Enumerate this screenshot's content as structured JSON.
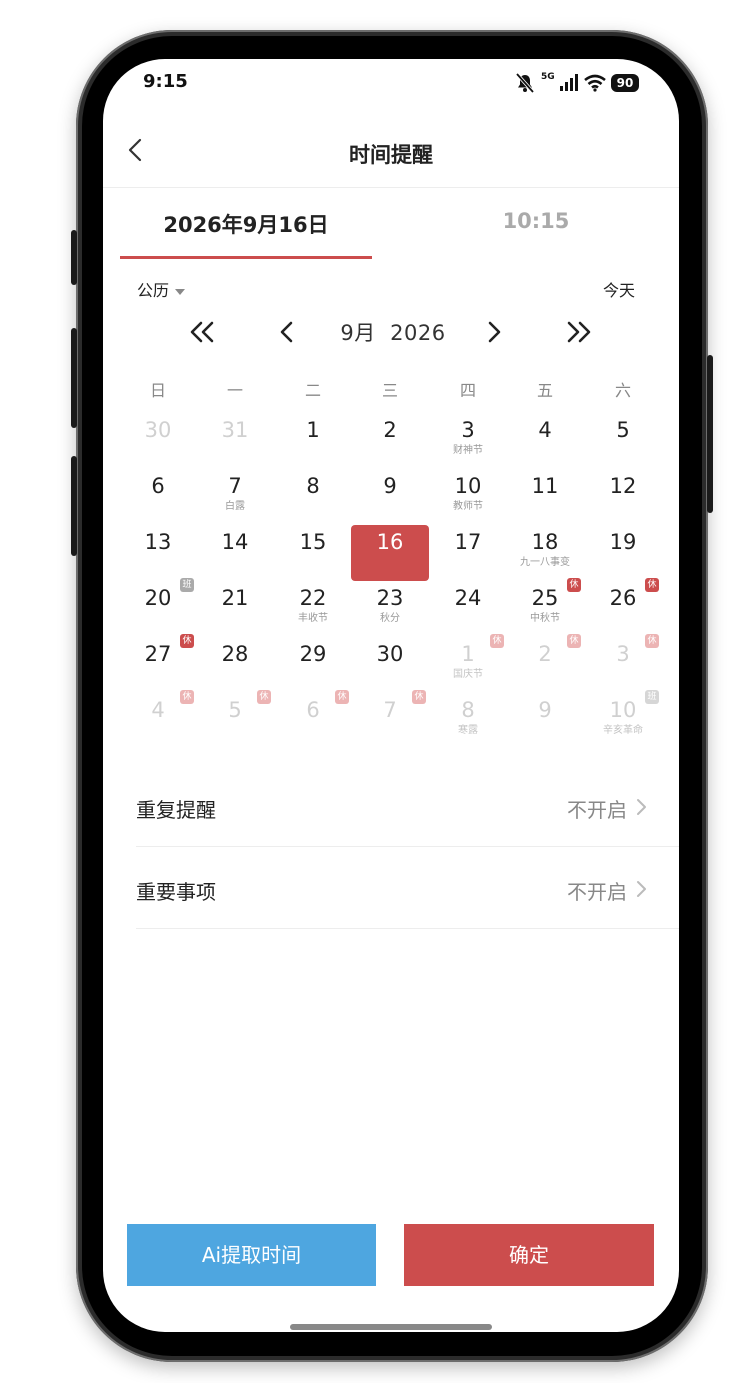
{
  "status_bar": {
    "time": "9:15",
    "network": "5G",
    "battery": "90"
  },
  "nav": {
    "title": "时间提醒"
  },
  "tabs": {
    "date": "2026年9月16日",
    "time": "10:15"
  },
  "calendar": {
    "type_label": "公历",
    "today_label": "今天",
    "month": "9月",
    "year": "2026",
    "weekdays": [
      "日",
      "一",
      "二",
      "三",
      "四",
      "五",
      "六"
    ],
    "weeks": [
      [
        {
          "d": "30",
          "dim": true
        },
        {
          "d": "31",
          "dim": true
        },
        {
          "d": "1"
        },
        {
          "d": "2"
        },
        {
          "d": "3",
          "sub": "财神节"
        },
        {
          "d": "4"
        },
        {
          "d": "5"
        }
      ],
      [
        {
          "d": "6"
        },
        {
          "d": "7",
          "sub": "白露"
        },
        {
          "d": "8"
        },
        {
          "d": "9"
        },
        {
          "d": "10",
          "sub": "教师节"
        },
        {
          "d": "11"
        },
        {
          "d": "12"
        }
      ],
      [
        {
          "d": "13"
        },
        {
          "d": "14"
        },
        {
          "d": "15"
        },
        {
          "d": "16",
          "selected": true
        },
        {
          "d": "17"
        },
        {
          "d": "18",
          "sub": "九一八事变"
        },
        {
          "d": "19"
        }
      ],
      [
        {
          "d": "20",
          "badge": "班",
          "badge_type": "work"
        },
        {
          "d": "21"
        },
        {
          "d": "22",
          "sub": "丰收节"
        },
        {
          "d": "23",
          "sub": "秋分"
        },
        {
          "d": "24"
        },
        {
          "d": "25",
          "sub": "中秋节",
          "badge": "休",
          "badge_type": "rest"
        },
        {
          "d": "26",
          "badge": "休",
          "badge_type": "rest"
        }
      ],
      [
        {
          "d": "27",
          "badge": "休",
          "badge_type": "rest"
        },
        {
          "d": "28"
        },
        {
          "d": "29"
        },
        {
          "d": "30"
        },
        {
          "d": "1",
          "dim": true,
          "sub": "国庆节",
          "badge": "休",
          "badge_type": "rest"
        },
        {
          "d": "2",
          "dim": true,
          "badge": "休",
          "badge_type": "rest"
        },
        {
          "d": "3",
          "dim": true,
          "badge": "休",
          "badge_type": "rest"
        }
      ],
      [
        {
          "d": "4",
          "dim": true,
          "badge": "休",
          "badge_type": "rest"
        },
        {
          "d": "5",
          "dim": true,
          "badge": "休",
          "badge_type": "rest"
        },
        {
          "d": "6",
          "dim": true,
          "badge": "休",
          "badge_type": "rest"
        },
        {
          "d": "7",
          "dim": true,
          "badge": "休",
          "badge_type": "rest"
        },
        {
          "d": "8",
          "dim": true,
          "sub": "寒露"
        },
        {
          "d": "9",
          "dim": true
        },
        {
          "d": "10",
          "dim": true,
          "sub": "辛亥革命",
          "badge": "班",
          "badge_type": "work"
        }
      ]
    ]
  },
  "settings": [
    {
      "label": "重复提醒",
      "value": "不开启"
    },
    {
      "label": "重要事项",
      "value": "不开启"
    }
  ],
  "buttons": {
    "ai": "Ai提取时间",
    "confirm": "确定"
  },
  "colors": {
    "accent_red": "#cc4d4d",
    "accent_blue": "#4ea6e0"
  }
}
